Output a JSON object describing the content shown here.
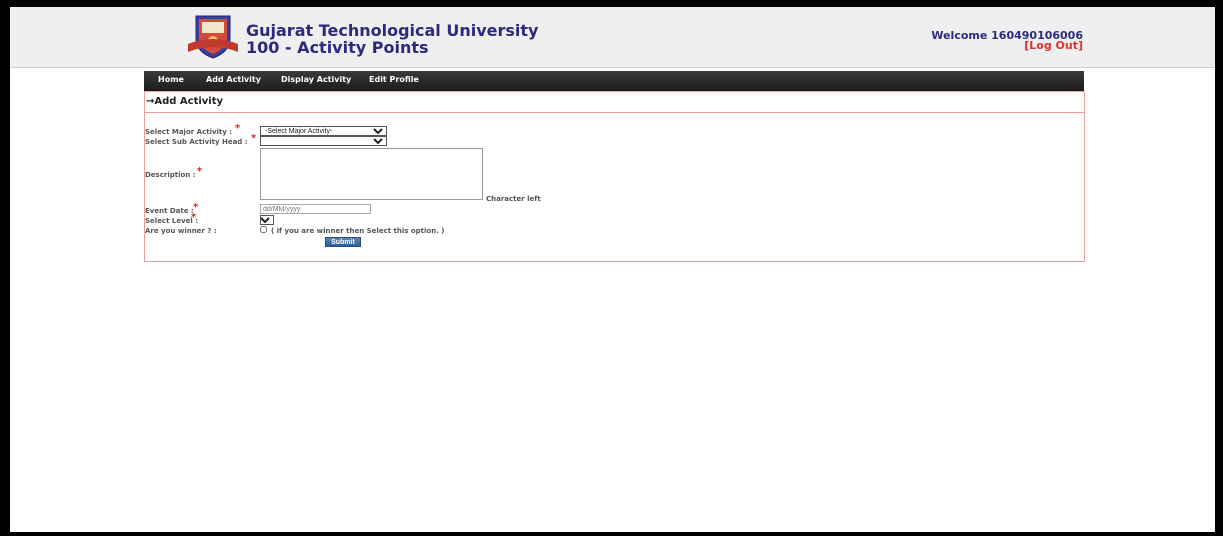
{
  "header": {
    "university_name": "Gujarat Technological University",
    "app_name": "100 - Activity Points",
    "welcome": "Welcome 160490106006",
    "logout": "[Log Out]"
  },
  "nav": {
    "items": [
      "Home",
      "Add Activity",
      "Display Activity",
      "Edit Profile"
    ]
  },
  "panel": {
    "title": "→Add Activity"
  },
  "form": {
    "major_activity_label": "Select Major Activity :",
    "major_activity_value": "-Select Major Activity-",
    "sub_activity_label": "Select Sub Activity Head :",
    "sub_activity_value": "",
    "description_label": "Description :",
    "char_left": "Character left",
    "event_date_label": "Event Date :",
    "event_date_placeholder": "dd/MM/yyyy",
    "level_label": "Select Level :",
    "level_value": "",
    "winner_label": "Are you winner ? :",
    "winner_hint": "( if you are winner then Select this option. )",
    "submit_label": "Submit",
    "required_mark": "*"
  },
  "colors": {
    "title_blue": "#2d2a7c",
    "logout_red": "#e03030",
    "panel_border": "#e6a0a0",
    "required_red": "#e02020"
  }
}
